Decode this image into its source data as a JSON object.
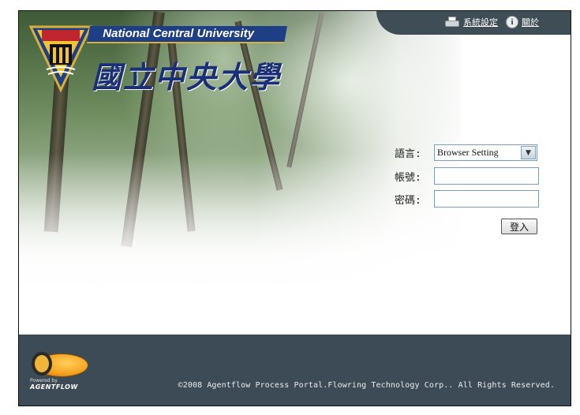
{
  "header": {
    "university_en": "National Central University",
    "university_zh": "國立中央大學",
    "seal_text": "國立中央大學",
    "links": [
      {
        "label": "系統設定",
        "icon": "printer-icon"
      },
      {
        "label": "關於",
        "icon": "info-icon"
      }
    ]
  },
  "login_form": {
    "language_label": "語言:",
    "language_value": "Browser Setting",
    "account_label": "帳號:",
    "account_value": "",
    "password_label": "密碼:",
    "password_value": "",
    "submit_label": "登入"
  },
  "footer": {
    "powered_by": "Powered by",
    "brand": "AGENTFLOW",
    "copyright": "©2008 Agentflow Process Portal.Flowring Technology Corp.. All Rights Reserved."
  },
  "colors": {
    "topbar": "#3e4d56",
    "footer": "#3c4b55",
    "banner": "#1e3f86"
  }
}
